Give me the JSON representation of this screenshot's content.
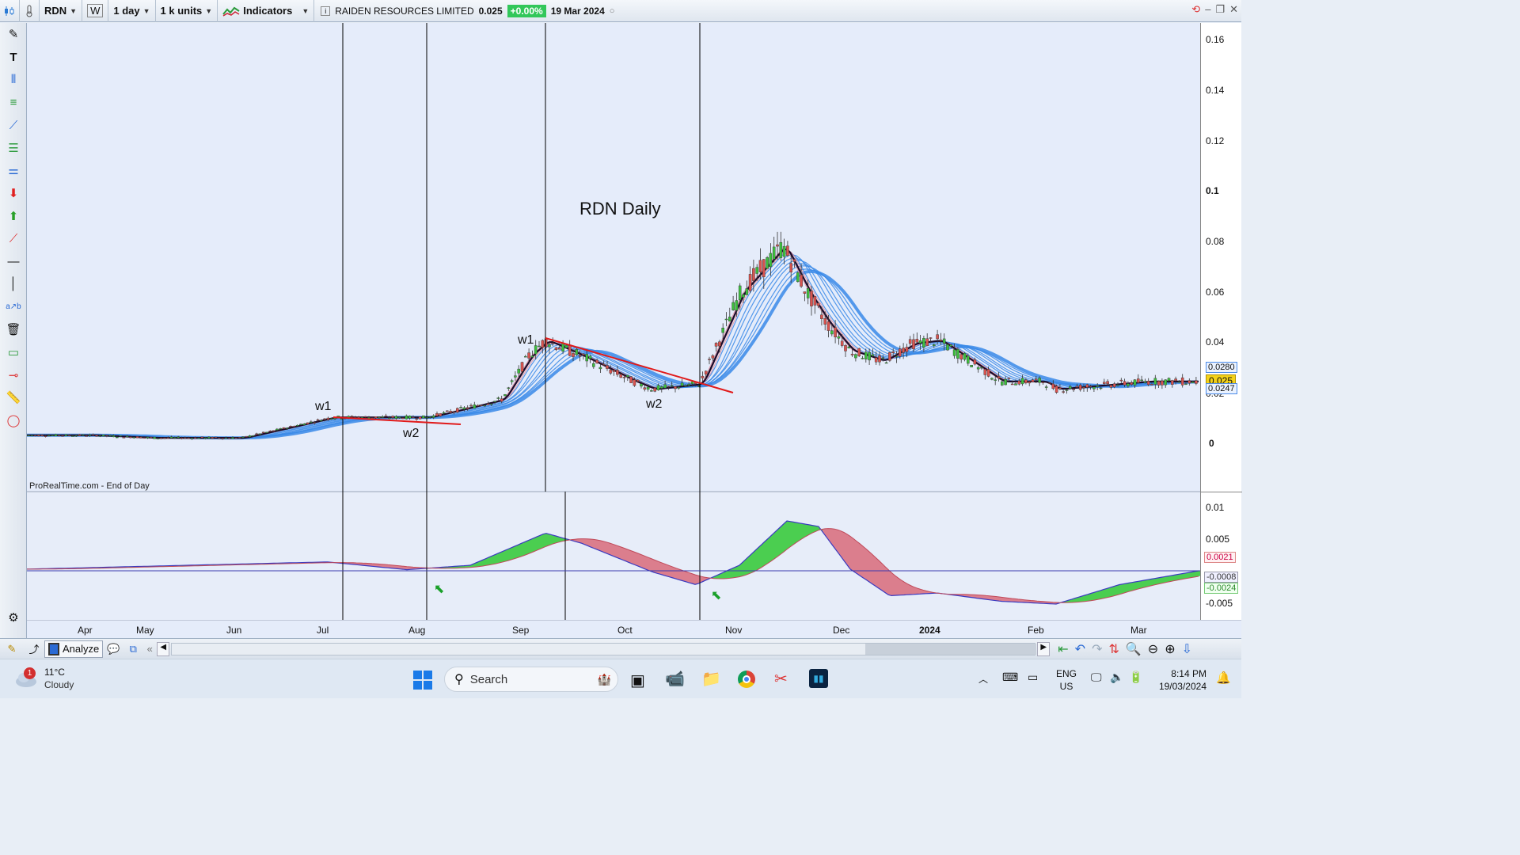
{
  "toolbar": {
    "ticker": "RDN",
    "period_btn": "W",
    "timeframe": "1 day",
    "units": "1 k units",
    "indicators_label": "Indicators",
    "instrument_name": "RAIDEN RESOURCES LIMITED",
    "price": "0.025",
    "change": "+0.00%",
    "date": "19 Mar 2024"
  },
  "chart": {
    "annotation_title": "RDN Daily",
    "watermark": "ProRealTime.com - End of Day",
    "wave_labels": [
      "w1",
      "w2",
      "w1",
      "w2"
    ],
    "price_axis": [
      "0.16",
      "0.14",
      "0.12",
      "0.1",
      "0.08",
      "0.06",
      "0.04",
      "0.02",
      "0"
    ],
    "price_tags": [
      "0.0280",
      "0.025",
      "0.0247"
    ],
    "indicator_axis": [
      "0.01",
      "0.005",
      "0",
      "-0.005"
    ],
    "indicator_tags": [
      "0.0021",
      "-0.0008",
      "-0.0024"
    ],
    "date_axis": [
      "Apr",
      "May",
      "Jun",
      "Jul",
      "Aug",
      "Sep",
      "Oct",
      "Nov",
      "Dec",
      "2024",
      "Feb",
      "Mar"
    ]
  },
  "chart_data": {
    "type": "line",
    "title": "RDN Daily",
    "series": [
      {
        "name": "RDN",
        "x": [
          "Apr",
          "May",
          "Jun",
          "Jul",
          "Aug",
          "Sep",
          "Oct",
          "Nov",
          "Dec",
          "2024",
          "Feb",
          "Mar"
        ],
        "values": [
          0.004,
          0.003,
          0.003,
          0.011,
          0.011,
          0.035,
          0.025,
          0.06,
          0.037,
          0.041,
          0.025,
          0.025
        ]
      }
    ],
    "ylim": [
      -0.018,
      0.165
    ],
    "grid": false
  },
  "bottombar": {
    "analyze_label": "Analyze"
  },
  "taskbar": {
    "weather_badge": "1",
    "temperature": "11°C",
    "condition": "Cloudy",
    "search_placeholder": "Search",
    "lang": "ENG",
    "region": "US",
    "time": "8:14 PM",
    "date": "19/03/2024"
  },
  "colors": {
    "candle_up": "#3dbe3d",
    "candle_down": "#d9534f",
    "ma_fast": "#1a0a2a",
    "ma_ribbon": "#3a8ae8",
    "trendline": "#e11a1a",
    "macd_green": "#2fc832",
    "macd_red": "#d86a7a"
  }
}
